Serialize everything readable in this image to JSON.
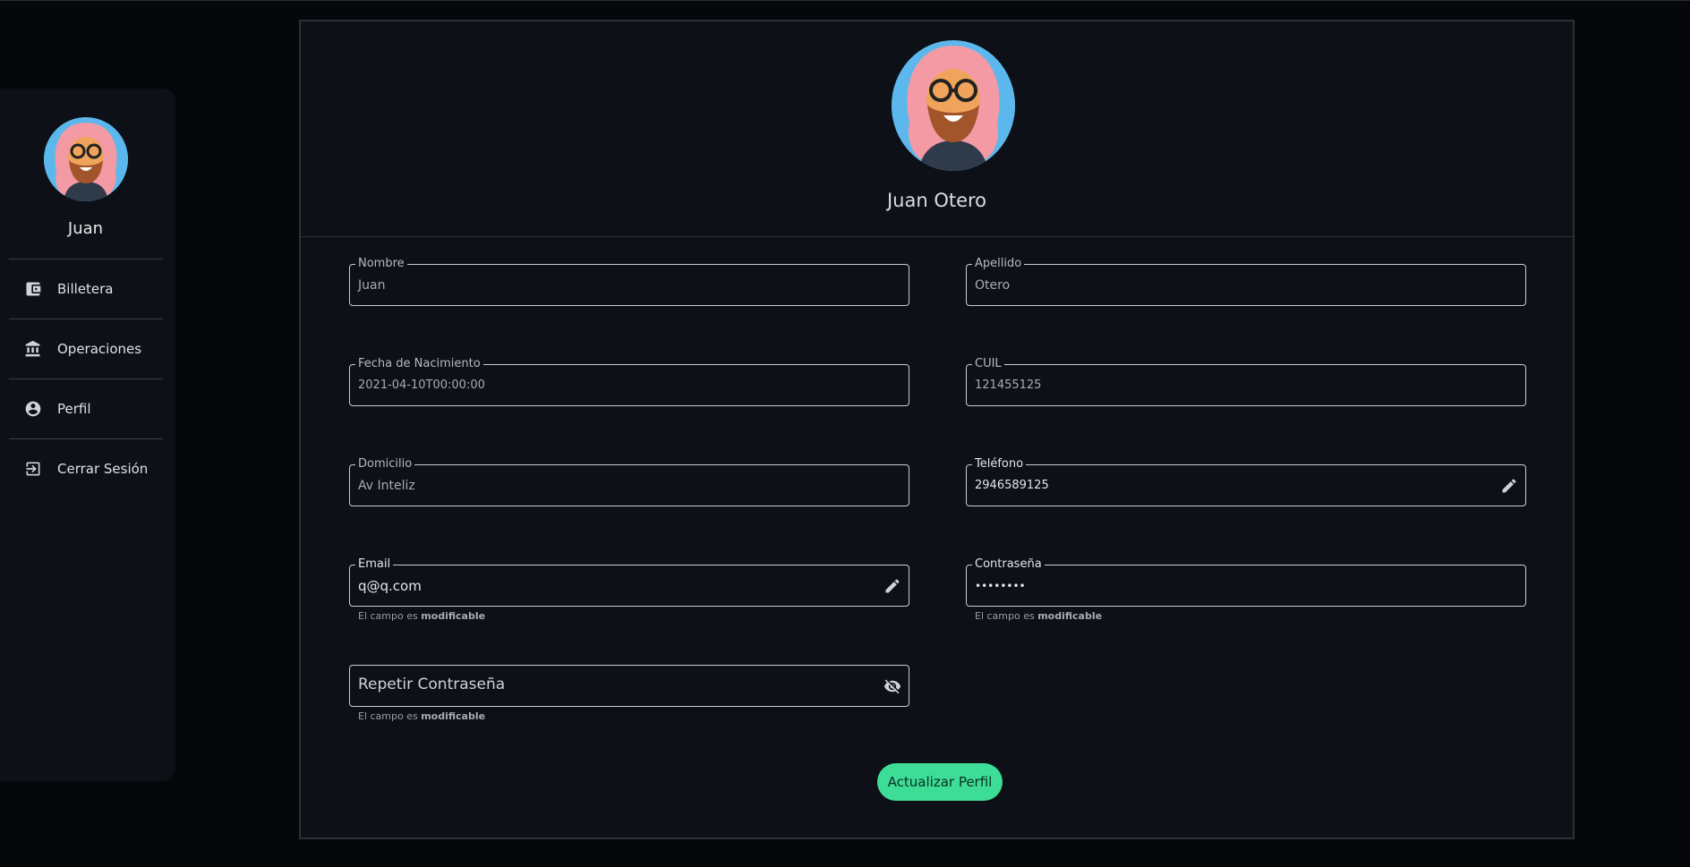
{
  "sidebar": {
    "user_name": "Juan",
    "items": [
      {
        "label": "Billetera",
        "icon": "wallet-icon"
      },
      {
        "label": "Operaciones",
        "icon": "bank-icon"
      },
      {
        "label": "Perfil",
        "icon": "account-circle-icon"
      },
      {
        "label": "Cerrar Sesión",
        "icon": "logout-icon"
      }
    ]
  },
  "profile": {
    "full_name": "Juan Otero"
  },
  "form": {
    "nombre": {
      "label": "Nombre",
      "value": "Juan"
    },
    "apellido": {
      "label": "Apellido",
      "value": "Otero"
    },
    "fecha": {
      "label": "Fecha de Nacimiento",
      "value": "2021-04-10T00:00:00"
    },
    "cuil": {
      "label": "CUIL",
      "value": "121455125"
    },
    "domicilio": {
      "label": "Domicilio",
      "value": "Av Inteliz"
    },
    "telefono": {
      "label": "Teléfono",
      "value": "2946589125",
      "icon": "pencil-icon"
    },
    "email": {
      "label": "Email",
      "value": "q@q.com",
      "icon": "pencil-icon"
    },
    "password": {
      "label": "Contraseña",
      "value": "••••••••"
    },
    "repeat_password": {
      "placeholder": "Repetir Contraseña",
      "icon": "eye-off-icon"
    },
    "helper_prefix": "El campo es ",
    "helper_bold": "modificable",
    "submit_label": "Actualizar Perfil"
  },
  "colors": {
    "background": "#05070b",
    "surface": "#0d1016",
    "accent": "#3ddc97"
  }
}
